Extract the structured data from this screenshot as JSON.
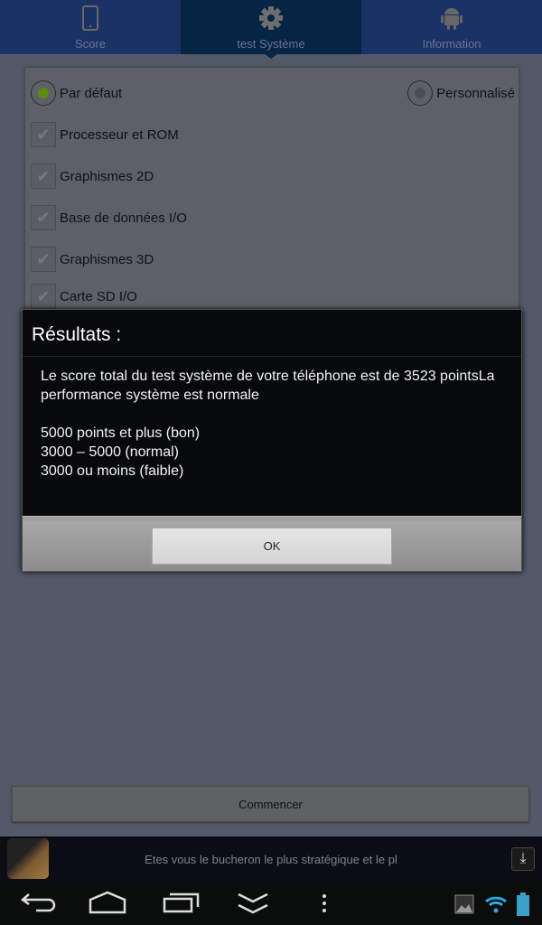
{
  "tabs": [
    {
      "label": "Score",
      "icon": "phone-icon"
    },
    {
      "label": "test Système",
      "icon": "gear-icon",
      "active": true
    },
    {
      "label": "Information",
      "icon": "android-icon"
    }
  ],
  "options": {
    "default_label": "Par défaut",
    "default_selected": true,
    "custom_label": "Personnalisé",
    "custom_selected": false,
    "checks": [
      {
        "label": "Processeur et ROM",
        "checked": true
      },
      {
        "label": "Graphismes 2D",
        "checked": true
      },
      {
        "label": "Base de données I/O",
        "checked": true
      },
      {
        "label": "Graphismes 3D",
        "checked": true
      },
      {
        "label": "Carte SD I/O",
        "checked": true
      }
    ]
  },
  "dialog": {
    "title": "Résultats :",
    "message": "Le score total du test système de votre téléphone est de 3523 pointsLa performance système est normale\n\n5000 points et plus (bon)\n3000 – 5000 (normal)\n3000 ou moins (faible)",
    "ok_label": "OK"
  },
  "start_label": "Commencer",
  "ad": {
    "text": "Etes vous le bucheron le plus stratégique et le pl"
  },
  "colors": {
    "accent_green": "#5a8a14",
    "wifi": "#2aa8e0",
    "battery": "#3aa0c8"
  }
}
